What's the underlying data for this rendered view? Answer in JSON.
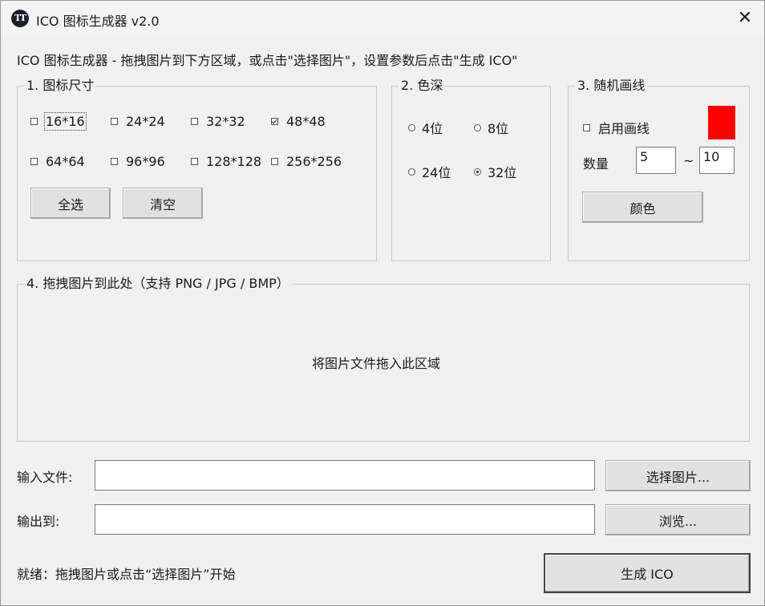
{
  "window": {
    "title": "ICO 图标生成器 v2.0",
    "icon_text": "TT",
    "close_glyph": "✕"
  },
  "instructions": "ICO 图标生成器  -  拖拽图片到下方区域，或点击\"选择图片\"，设置参数后点击\"生成 ICO\"",
  "sizes": {
    "legend": "1. 图标尺寸",
    "items": [
      {
        "label": "16*16",
        "checked": false
      },
      {
        "label": "24*24",
        "checked": false
      },
      {
        "label": "32*32",
        "checked": false
      },
      {
        "label": "48*48",
        "checked": true
      },
      {
        "label": "64*64",
        "checked": false
      },
      {
        "label": "96*96",
        "checked": false
      },
      {
        "label": "128*128",
        "checked": false
      },
      {
        "label": "256*256",
        "checked": false
      }
    ],
    "select_all_label": "全选",
    "clear_label": "清空"
  },
  "depth": {
    "legend": "2. 色深",
    "options": [
      {
        "label": "4位",
        "selected": false
      },
      {
        "label": "8位",
        "selected": false
      },
      {
        "label": "24位",
        "selected": false
      },
      {
        "label": "32位",
        "selected": true
      }
    ]
  },
  "lines": {
    "legend": "3. 随机画线",
    "enable_label": "启用画线",
    "enabled": false,
    "swatch_color": "#ff0000",
    "count_label": "数量",
    "min_value": "5",
    "tilde": "~",
    "max_value": "10",
    "color_button_label": "颜色"
  },
  "drop": {
    "legend": "4. 拖拽图片到此处（支持 PNG / JPG / BMP）",
    "hint": "将图片文件拖入此区域"
  },
  "input_file": {
    "label": "输入文件:",
    "value": "",
    "button_label": "选择图片..."
  },
  "output": {
    "label": "输出到:",
    "value": "",
    "button_label": "浏览..."
  },
  "status": "就绪：拖拽图片或点击“选择图片”开始",
  "generate_label": "生成 ICO"
}
